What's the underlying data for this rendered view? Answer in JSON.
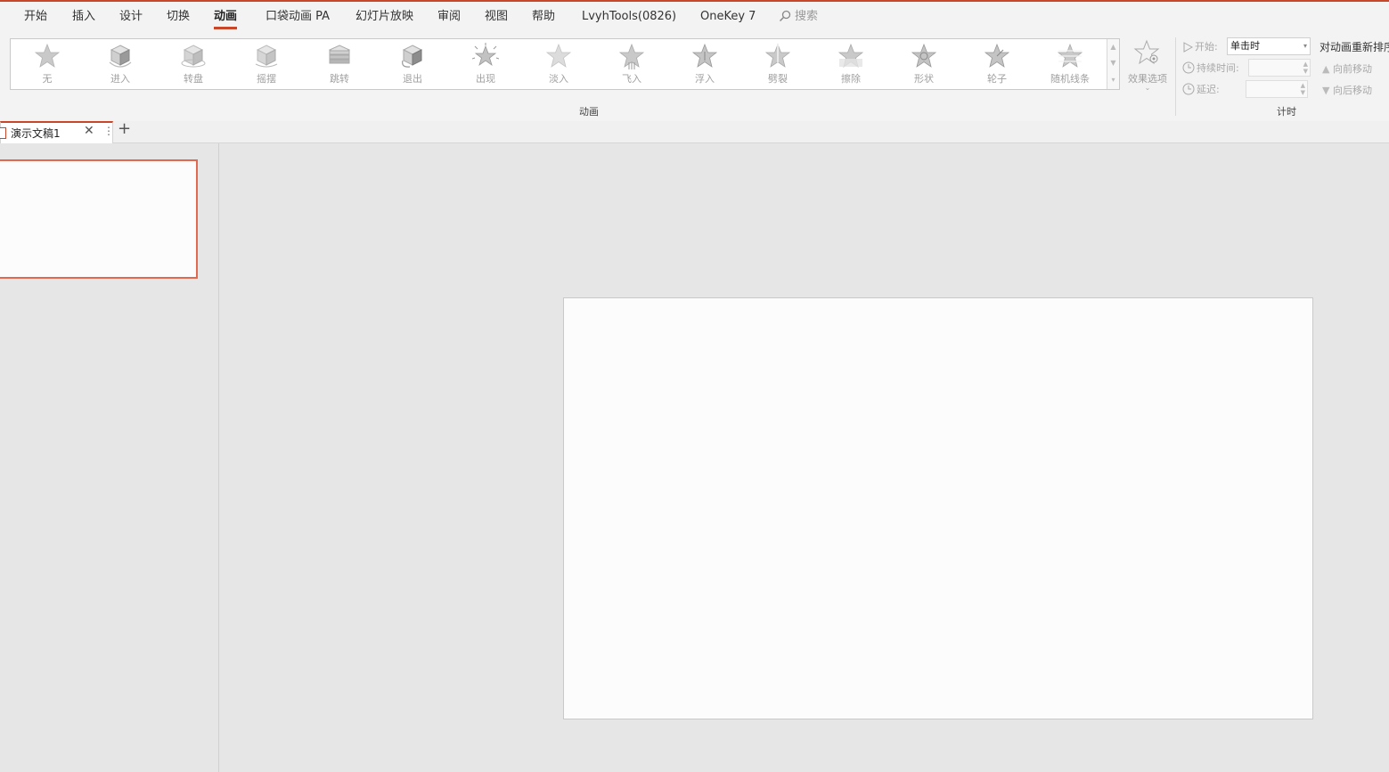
{
  "menu": {
    "tabs": [
      {
        "label": "开始"
      },
      {
        "label": "插入"
      },
      {
        "label": "设计"
      },
      {
        "label": "切换"
      },
      {
        "label": "动画"
      },
      {
        "label": "口袋动画 PA"
      },
      {
        "label": "幻灯片放映"
      },
      {
        "label": "审阅"
      },
      {
        "label": "视图"
      },
      {
        "label": "帮助"
      },
      {
        "label": "LvyhTools(0826)"
      },
      {
        "label": "OneKey 7"
      }
    ],
    "active_tab": "动画",
    "search_placeholder": "搜索"
  },
  "ribbon": {
    "animation_group_label": "动画",
    "animations": [
      {
        "label": "无",
        "icon": "star-icon"
      },
      {
        "label": "进入",
        "icon": "cube-enter-icon"
      },
      {
        "label": "转盘",
        "icon": "cube-spin-icon"
      },
      {
        "label": "摇摆",
        "icon": "cube-swing-icon"
      },
      {
        "label": "跳转",
        "icon": "cube-jump-icon"
      },
      {
        "label": "退出",
        "icon": "cube-exit-icon"
      },
      {
        "label": "出现",
        "icon": "star-burst-icon"
      },
      {
        "label": "淡入",
        "icon": "star-fade-icon"
      },
      {
        "label": "飞入",
        "icon": "star-fly-icon"
      },
      {
        "label": "浮入",
        "icon": "star-float-icon"
      },
      {
        "label": "劈裂",
        "icon": "star-split-icon"
      },
      {
        "label": "擦除",
        "icon": "star-wipe-icon"
      },
      {
        "label": "形状",
        "icon": "star-shape-icon"
      },
      {
        "label": "轮子",
        "icon": "star-wheel-icon"
      },
      {
        "label": "随机线条",
        "icon": "star-random-bars-icon"
      }
    ],
    "effect_options_label": "效果选项",
    "timing": {
      "group_label": "计时",
      "start_label": "开始:",
      "start_value": "单击时",
      "duration_label": "持续时间:",
      "duration_value": "",
      "delay_label": "延迟:",
      "delay_value": ""
    },
    "reorder": {
      "title": "对动画重新排序",
      "move_earlier": "向前移动",
      "move_later": "向后移动"
    }
  },
  "document": {
    "tab_name": "演示文稿1"
  },
  "colors": {
    "accent": "#c8462a",
    "thumb_border": "#e0694f"
  }
}
